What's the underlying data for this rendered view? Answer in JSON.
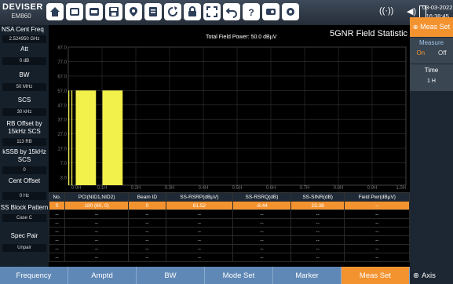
{
  "device": {
    "brand": "DEVISER",
    "model": "EM860"
  },
  "status": {
    "date": "03-03-2022",
    "time": "16:38:45"
  },
  "left_panel": [
    {
      "label": "NSA Cent Freq",
      "value": "2.524950 GHz"
    },
    {
      "label": "Att",
      "value": "0 dB"
    },
    {
      "label": "BW",
      "value": "50 MHz"
    },
    {
      "label": "SCS",
      "value": "30 kHz"
    },
    {
      "label": "RB Offset by 15kHz SCS",
      "value": "113 RB"
    },
    {
      "label": "kSSB by 15kHz SCS",
      "value": "0"
    },
    {
      "label": "Cent Offset",
      "value": "0 Hz"
    },
    {
      "label": "SS Block Pattern",
      "value": "Case C"
    },
    {
      "label": "Spec Pair",
      "value": "Unpair"
    }
  ],
  "chart": {
    "title": "5GNR Field Statistic",
    "total_power": "Total Field Power:  50.0 dBµV"
  },
  "chart_data": {
    "type": "bar",
    "y_ticks": [
      "87.0",
      "77.0",
      "67.0",
      "57.0",
      "47.0",
      "37.0",
      "27.0",
      "17.0",
      "7.0",
      "3.0"
    ],
    "x_ticks": [
      "0 0H",
      "0.1H",
      "0.2H",
      "0.3H",
      "0.4H",
      "0.5H",
      "0.6H",
      "0.7H",
      "0.8H",
      "0.9H",
      "1.0H"
    ],
    "bars": [
      {
        "x0": 0.0,
        "x1": 0.003,
        "value": 57.0
      },
      {
        "x0": 0.009,
        "x1": 0.012,
        "value": 57.0
      },
      {
        "x0": 0.022,
        "x1": 0.082,
        "value": 57.0
      },
      {
        "x0": 0.101,
        "x1": 0.161,
        "value": 57.0
      }
    ],
    "ylim": [
      0,
      87
    ]
  },
  "table": {
    "headers": [
      "No.",
      "PCI(NID1,NID2)",
      "Beam ID",
      "SS-RSRP(dBµV)",
      "SS-RSRQ(dB)",
      "SS-SINR(dB)",
      "Field Pwr(dBµV)"
    ],
    "rows": [
      [
        "0",
        "180 (60, 0)",
        "0",
        "61.52",
        "-8.44",
        "23.38",
        "--"
      ],
      [
        "--",
        "--",
        "--",
        "--",
        "--",
        "--",
        "--"
      ],
      [
        "--",
        "--",
        "--",
        "--",
        "--",
        "--",
        "--"
      ],
      [
        "--",
        "--",
        "--",
        "--",
        "--",
        "--",
        "--"
      ],
      [
        "--",
        "--",
        "--",
        "--",
        "--",
        "--",
        "--"
      ],
      [
        "--",
        "--",
        "--",
        "--",
        "--",
        "--",
        "--"
      ],
      [
        "--",
        "--",
        "--",
        "--",
        "--",
        "--",
        "--"
      ]
    ]
  },
  "right_panel": {
    "header": "Meas Set",
    "measure": {
      "label": "Measure",
      "on": "On",
      "off": "Off"
    },
    "time": {
      "label": "Time",
      "value": "1 H"
    }
  },
  "bottom_bar": {
    "buttons": [
      "Frequency",
      "Amptd",
      "BW",
      "Mode Set",
      "Marker",
      "Meas Set"
    ],
    "axis": "Axis"
  },
  "colors": {
    "accent": "#f39330",
    "bar": "#f2f04a",
    "bottom": "#5f88b6"
  }
}
